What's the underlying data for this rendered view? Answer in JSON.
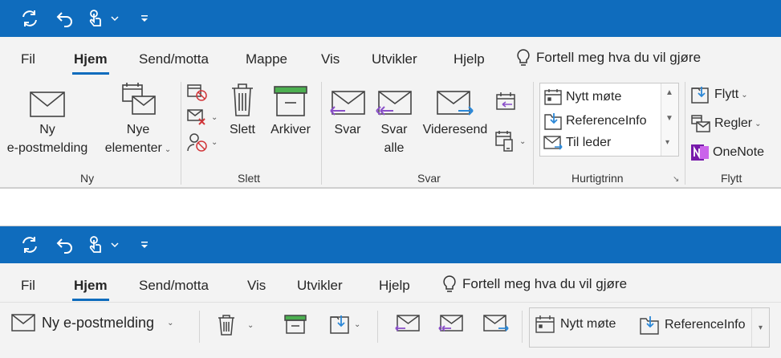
{
  "colors": {
    "accent": "#0f6cbd",
    "ribbon_bg": "#f3f3f3",
    "red": "#d13438",
    "green": "#4caf50",
    "purple": "#8a4fc9",
    "blue": "#2b88d8"
  },
  "qat": {
    "icons": [
      "sync-icon",
      "undo-icon",
      "touch-mode-icon",
      "chevron-down-icon",
      "customize-qat-icon"
    ]
  },
  "ribbon1": {
    "tabs": [
      "Fil",
      "Hjem",
      "Send/motta",
      "Mappe",
      "Vis",
      "Utvikler",
      "Hjelp"
    ],
    "tellme": "Fortell meg hva du vil gjøre",
    "groups": {
      "ny": {
        "label": "Ny",
        "new_email_line1": "Ny",
        "new_email_line2": "e-postmelding",
        "new_items_line1": "Nye",
        "new_items_line2": "elementer"
      },
      "slett": {
        "label": "Slett",
        "delete": "Slett",
        "archive": "Arkiver"
      },
      "svar": {
        "label": "Svar",
        "reply": "Svar",
        "reply_all_line1": "Svar",
        "reply_all_line2": "alle",
        "forward": "Videresend"
      },
      "hurtigtrinn": {
        "label": "Hurtigtrinn",
        "items": [
          "Nytt møte",
          "ReferenceInfo",
          "Til leder"
        ]
      },
      "flytt": {
        "label": "Flytt",
        "move": "Flytt",
        "rules": "Regler",
        "onenote": "OneNote"
      }
    }
  },
  "ribbon2": {
    "tabs": [
      "Fil",
      "Hjem",
      "Send/motta",
      "Vis",
      "Utvikler",
      "Hjelp"
    ],
    "tellme": "Fortell meg hva du vil gjøre",
    "new_email": "Ny e-postmelding",
    "quicksteps": [
      "Nytt møte",
      "ReferenceInfo"
    ]
  }
}
